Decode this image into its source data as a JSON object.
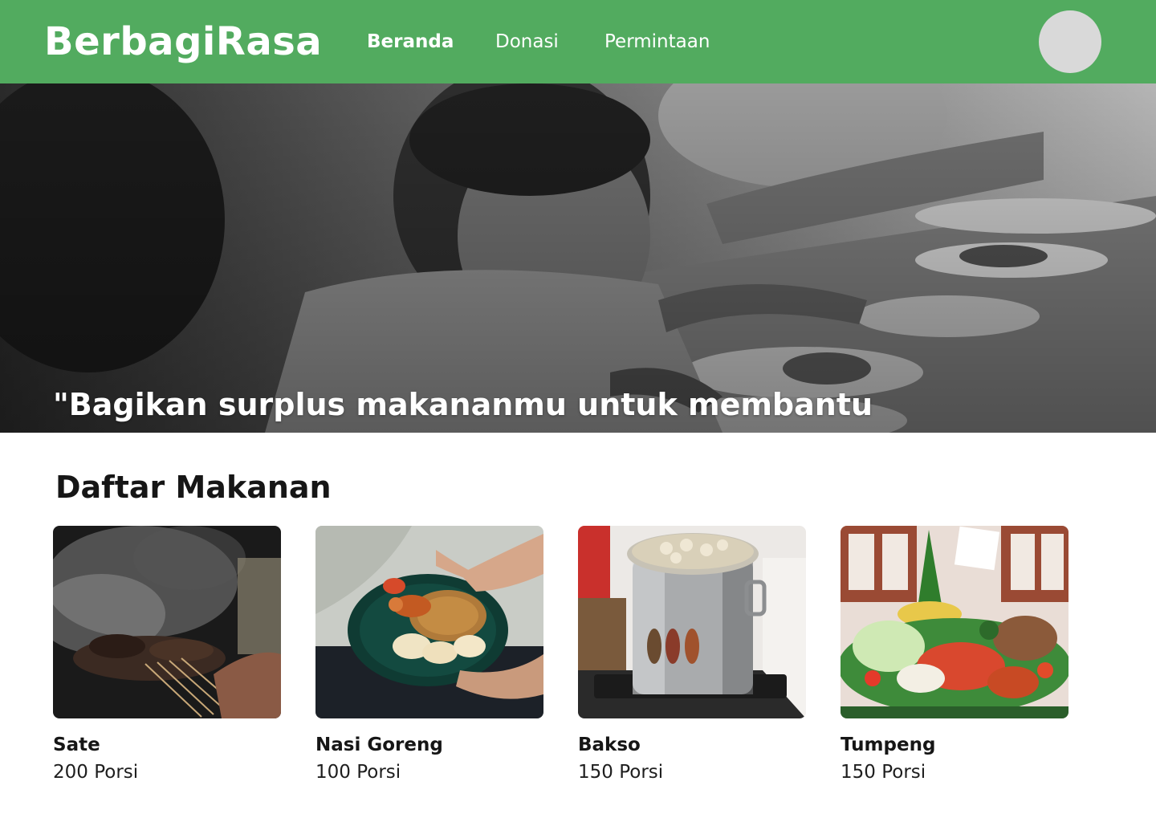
{
  "header": {
    "brand": "BerbagiRasa",
    "nav": [
      {
        "label": "Beranda",
        "active": true
      },
      {
        "label": "Donasi",
        "active": false
      },
      {
        "label": "Permintaan",
        "active": false
      }
    ],
    "accent_color": "#52ab5f"
  },
  "hero": {
    "quote": "\"Bagikan surplus makananmu untuk membantu panti asuhan yang membutuhkan.\""
  },
  "main": {
    "section_title": "Daftar Makanan",
    "foods": [
      {
        "name": "Sate",
        "quantity": "200 Porsi"
      },
      {
        "name": "Nasi Goreng",
        "quantity": "100 Porsi"
      },
      {
        "name": "Bakso",
        "quantity": "150 Porsi"
      },
      {
        "name": "Tumpeng",
        "quantity": "150 Porsi"
      }
    ]
  }
}
